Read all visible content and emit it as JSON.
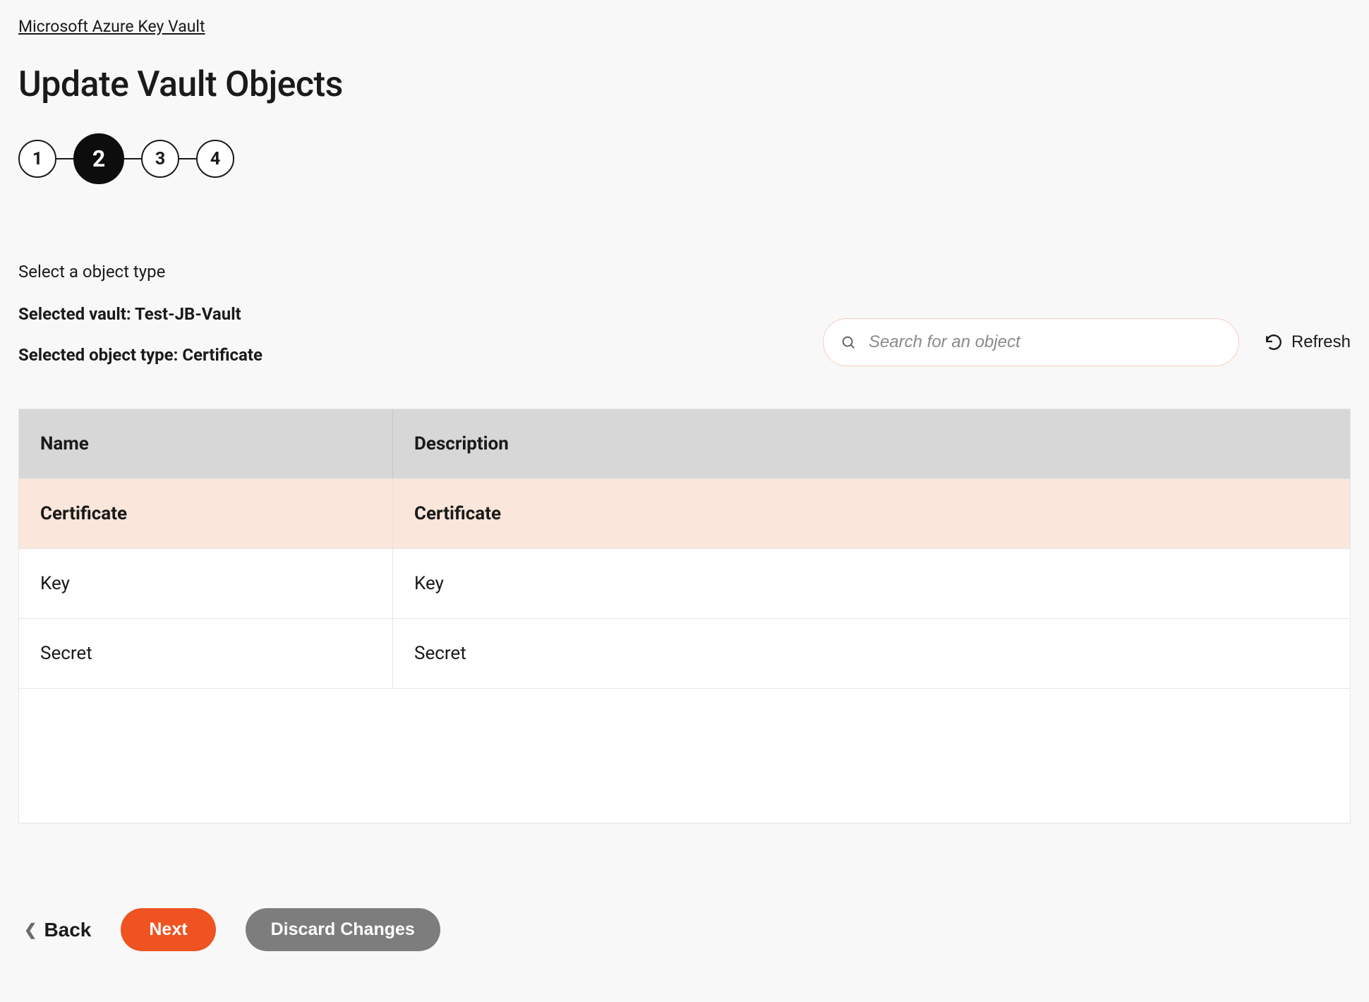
{
  "breadcrumb": "Microsoft Azure Key Vault",
  "page_title": "Update Vault Objects",
  "stepper": {
    "steps": [
      "1",
      "2",
      "3",
      "4"
    ],
    "active_index": 1
  },
  "section": {
    "subtitle": "Select a object type",
    "selected_vault_label": "Selected vault: Test-JB-Vault",
    "selected_type_label": "Selected object type: Certificate"
  },
  "search": {
    "placeholder": "Search for an object",
    "value": ""
  },
  "refresh_label": "Refresh",
  "table": {
    "headers": {
      "name": "Name",
      "description": "Description"
    },
    "rows": [
      {
        "name": "Certificate",
        "description": "Certificate",
        "selected": true
      },
      {
        "name": "Key",
        "description": "Key",
        "selected": false
      },
      {
        "name": "Secret",
        "description": "Secret",
        "selected": false
      }
    ]
  },
  "buttons": {
    "back": "Back",
    "next": "Next",
    "discard": "Discard Changes"
  }
}
